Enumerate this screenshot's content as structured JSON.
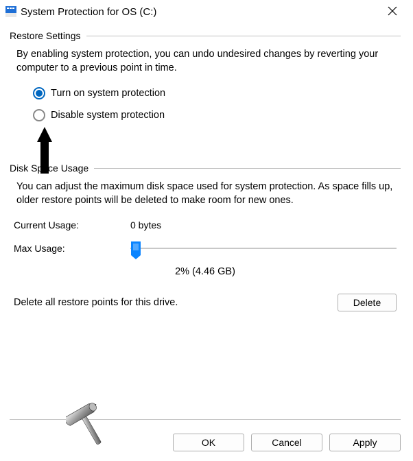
{
  "title": "System Protection for OS (C:)",
  "sections": {
    "restore": {
      "label": "Restore Settings",
      "desc": "By enabling system protection, you can undo undesired changes by reverting your computer to a previous point in time.",
      "options": {
        "turn_on": "Turn on system protection",
        "disable": "Disable system protection"
      },
      "selected": "turn_on"
    },
    "disk": {
      "label": "Disk Space Usage",
      "desc": "You can adjust the maximum disk space used for system protection. As space fills up, older restore points will be deleted to make room for new ones.",
      "current_label": "Current Usage:",
      "current_value": "0 bytes",
      "max_label": "Max Usage:",
      "usage_readout": "2% (4.46 GB)"
    },
    "delete": {
      "text": "Delete all restore points for this drive.",
      "button": "Delete"
    }
  },
  "buttons": {
    "ok": "OK",
    "cancel": "Cancel",
    "apply": "Apply"
  }
}
